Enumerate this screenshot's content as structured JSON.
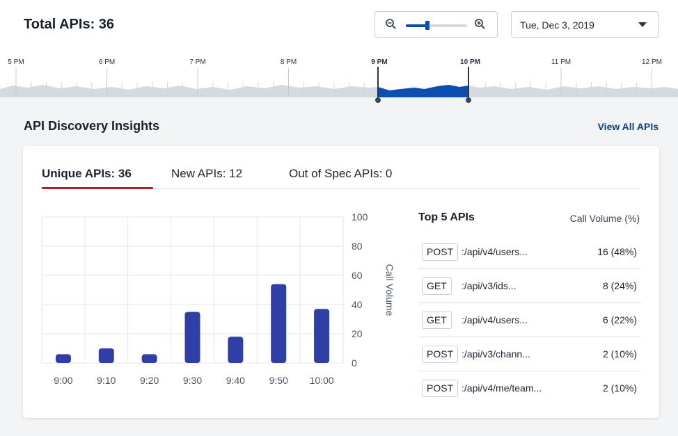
{
  "header": {
    "title": "Total APIs: 36",
    "date": "Tue, Dec 3, 2019",
    "zoom_level_fraction": 0.35
  },
  "timeline": {
    "ticks": [
      "5 PM",
      "6 PM",
      "7 PM",
      "8 PM",
      "9 PM",
      "10 PM",
      "11 PM",
      "12 PM"
    ],
    "selected_range": [
      "9 PM",
      "10 PM"
    ]
  },
  "insights": {
    "title": "API Discovery Insights",
    "view_all": "View All APIs"
  },
  "tabs": [
    {
      "label": "Unique APIs: 36",
      "active": true
    },
    {
      "label": "New APIs: 12",
      "active": false
    },
    {
      "label": "Out of Spec APIs: 0",
      "active": false
    }
  ],
  "chart_data": {
    "type": "bar",
    "categories": [
      "9:00",
      "9:10",
      "9:20",
      "9:30",
      "9:40",
      "9:50",
      "10:00"
    ],
    "values": [
      6,
      10,
      6,
      35,
      18,
      54,
      37
    ],
    "ylabel": "Call Volume",
    "ylim": [
      0,
      100
    ],
    "yticks": [
      100,
      80,
      60,
      40,
      20,
      0
    ],
    "bar_color": "#2f3fa5",
    "axis_side": "right",
    "grid": true
  },
  "top_apis": {
    "title": "Top 5 APIs",
    "volume_header": "Call Volume (%)",
    "rows": [
      {
        "method": "POST",
        "path": ":/api/v4/users...",
        "volume": "16 (48%)"
      },
      {
        "method": "GET",
        "path": ":/api/v3/ids...",
        "volume": "8 (24%)"
      },
      {
        "method": "GET",
        "path": ":/api/v4/users...",
        "volume": "6 (22%)"
      },
      {
        "method": "POST",
        "path": ":/api/v3/chann...",
        "volume": "2 (10%)"
      },
      {
        "method": "POST",
        "path": ":/api/v4/me/team...",
        "volume": "2 (10%)"
      }
    ]
  },
  "colors": {
    "accent": "#0b4fb3",
    "tab_underline": "#b71c2a",
    "bar": "#2f3fa5",
    "link": "#0d3f7a"
  }
}
